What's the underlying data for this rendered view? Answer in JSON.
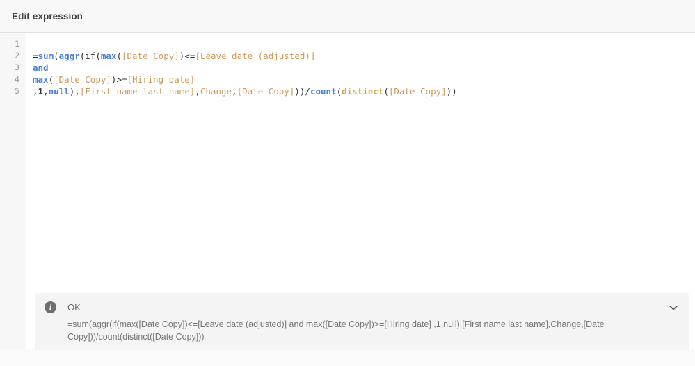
{
  "header": {
    "title": "Edit expression"
  },
  "editor": {
    "gutter_lines": [
      "1",
      "2",
      "3",
      "4",
      "5"
    ],
    "lines": [
      {
        "number": "1",
        "tokens": []
      },
      {
        "number": "2",
        "tokens": [
          {
            "text": "=",
            "type": "plain"
          },
          {
            "text": "sum",
            "type": "func"
          },
          {
            "text": "(",
            "type": "plain"
          },
          {
            "text": "aggr",
            "type": "func"
          },
          {
            "text": "(",
            "type": "plain"
          },
          {
            "text": "if",
            "type": "plain"
          },
          {
            "text": "(",
            "type": "plain"
          },
          {
            "text": "max",
            "type": "func"
          },
          {
            "text": "(",
            "type": "plain"
          },
          {
            "text": "[Date Copy]",
            "type": "field"
          },
          {
            "text": ")",
            "type": "plain"
          },
          {
            "text": "<=",
            "type": "plain"
          },
          {
            "text": "[Leave date (adjusted)]",
            "type": "field"
          }
        ]
      },
      {
        "number": "3",
        "tokens": [
          {
            "text": "and",
            "type": "keyword"
          }
        ]
      },
      {
        "number": "4",
        "tokens": [
          {
            "text": "max",
            "type": "func"
          },
          {
            "text": "(",
            "type": "plain"
          },
          {
            "text": "[Date Copy]",
            "type": "field"
          },
          {
            "text": ")",
            "type": "plain"
          },
          {
            "text": ">=",
            "type": "plain"
          },
          {
            "text": "[Hiring date]",
            "type": "field"
          }
        ]
      },
      {
        "number": "5",
        "tokens": [
          {
            "text": ",",
            "type": "plain"
          },
          {
            "text": "1",
            "type": "number"
          },
          {
            "text": ",",
            "type": "plain"
          },
          {
            "text": "null",
            "type": "keyword"
          },
          {
            "text": ")",
            "type": "plain"
          },
          {
            "text": ",",
            "type": "plain"
          },
          {
            "text": "[First name last name]",
            "type": "field"
          },
          {
            "text": ",",
            "type": "plain"
          },
          {
            "text": "Change",
            "type": "field"
          },
          {
            "text": ",",
            "type": "plain"
          },
          {
            "text": "[Date Copy]",
            "type": "field"
          },
          {
            "text": "))",
            "type": "plain"
          },
          {
            "text": "/",
            "type": "plain"
          },
          {
            "text": "count",
            "type": "func"
          },
          {
            "text": "(",
            "type": "plain"
          },
          {
            "text": "distinct",
            "type": "qualifier"
          },
          {
            "text": "(",
            "type": "plain"
          },
          {
            "text": "[Date Copy]",
            "type": "field"
          },
          {
            "text": "))",
            "type": "plain"
          }
        ]
      }
    ],
    "plain_text": "=sum(aggr(if(max([Date Copy])<=[Leave date (adjusted)]\nand\nmax([Date Copy])>=[Hiring date]\n,1,null),[First name last name],Change,[Date Copy]))/count(distinct([Date Copy]))"
  },
  "status": {
    "icon": "info-icon",
    "icon_glyph": "i",
    "label": "OK",
    "expression": "=sum(aggr(if(max([Date Copy])<=[Leave date (adjusted)] and max([Date Copy])>=[Hiring date] ,1,null),[First name last name],Change,[Date Copy]))/count(distinct([Date Copy]))",
    "collapse_icon": "chevron-down-icon"
  },
  "colors": {
    "function_blue": "#4a80cf",
    "field_orange": "#cc9a5c",
    "qualifier_gold": "#d4a857",
    "plain_text": "#333333",
    "gutter_number": "#999999",
    "header_text": "#404040",
    "status_text": "#767676",
    "info_icon_bg": "#6e6e6e",
    "panel_bg": "#f4f4f4",
    "header_bg": "#f8f8f8",
    "gutter_bg": "#f7f7f7",
    "editor_bg": "#ffffff"
  }
}
